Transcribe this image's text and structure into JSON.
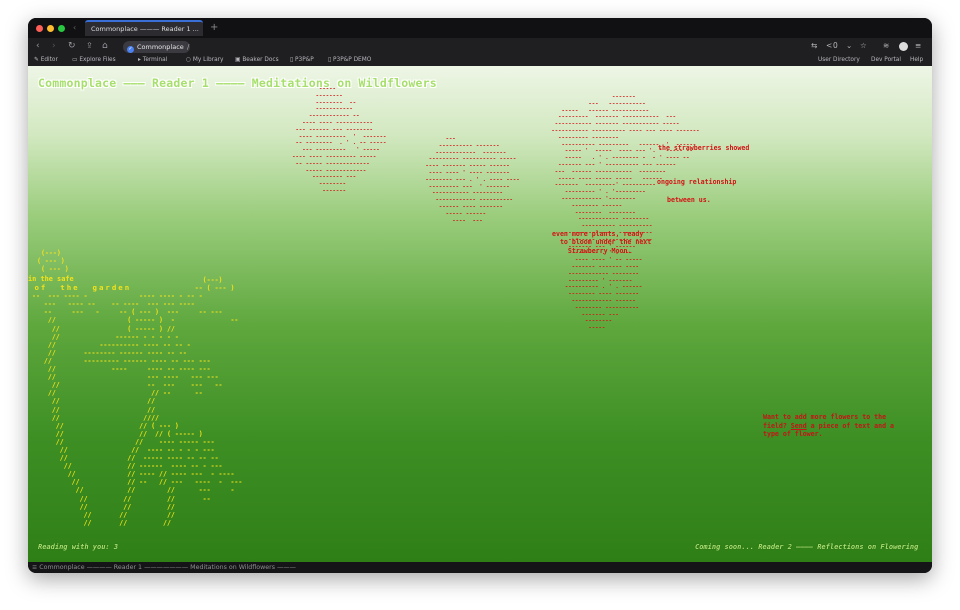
{
  "browser": {
    "tab_title": "Commonplace ——— Reader 1 ...",
    "url_label": "Commonplace",
    "url_suffix": "/",
    "share_count": "0",
    "bookmarks": [
      "Editor",
      "Explore Files",
      "Terminal",
      "My Library",
      "Beaker Docs",
      "P3P&P",
      "P3P&P DEMO"
    ],
    "bookmarks_right": [
      "User Directory",
      "Dev Portal",
      "Help"
    ]
  },
  "page": {
    "title": "Commonplace ——— Reader 1 ———— Meditations on Wildflowers",
    "annotation_1": "the strawberries showed",
    "annotation_2": "ongoing relationship",
    "annotation_3": "between us.",
    "annotation_4": "even more plants, ready\n  to bloom under the next\n    Strawberry Moon.",
    "garden_line_1": "in the safe",
    "garden_line_2": " of  the  garden",
    "cta_before": "Want to add more flowers to the field? ",
    "cta_link": "Send",
    "cta_after": " a piece of text and a type of flower.",
    "footer_left": "Reading with you: 3",
    "footer_right": "Coming soon... Reader 2 ———— Reflections on Flowering",
    "status_text": "≡ Commonplace ———— Reader 1 ——————— Meditations on Wildflowers ———"
  },
  "colors": {
    "ascii_red": "#d21414",
    "ascii_yellow": "#f3e21a",
    "title_green": "#a6df6b"
  }
}
